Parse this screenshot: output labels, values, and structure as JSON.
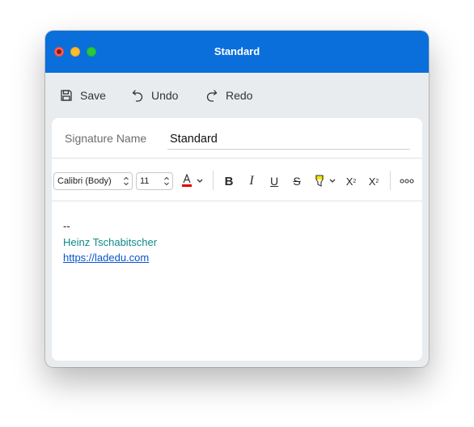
{
  "window": {
    "title": "Standard"
  },
  "toolbar": {
    "save_label": "Save",
    "undo_label": "Undo",
    "redo_label": "Redo"
  },
  "signature": {
    "name_label": "Signature Name",
    "name_value": "Standard"
  },
  "format": {
    "font_family": "Calibri (Body)",
    "font_size": "11",
    "font_color": "#d90000",
    "highlight_color": "#f5e600"
  },
  "body": {
    "line1": "--",
    "line2": "Heinz Tschabitscher",
    "line3": "https://ladedu.com"
  },
  "colors": {
    "titlebar": "#0a6fdb",
    "name_text": "#0d8a86",
    "link_text": "#0a55c8"
  }
}
